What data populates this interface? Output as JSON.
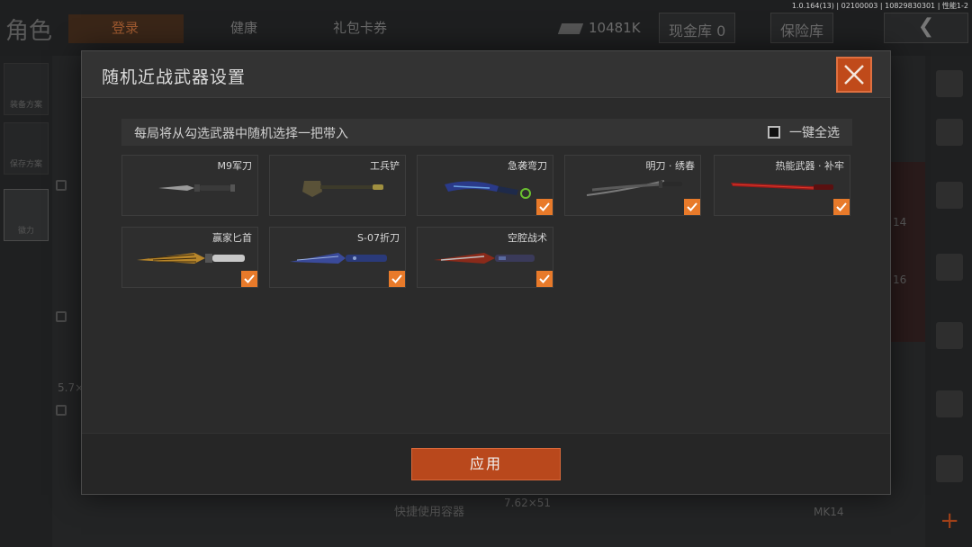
{
  "version": "1.0.164(13) | 02100003 | 10829830301 | 性能1-2",
  "background": {
    "title": "角色",
    "tabs": [
      {
        "label": "登录",
        "active": true
      },
      {
        "label": "健康",
        "active": false
      },
      {
        "label": "礼包卡券",
        "active": false
      }
    ],
    "money": "10481K",
    "cash_vault": "现金库 0",
    "safe_box": "保险库",
    "side_buttons": [
      "装备方案",
      "保存方案",
      "徽力"
    ],
    "bottom_text": "快捷使用容器",
    "left_text": "5.7×",
    "right_texts": [
      "14",
      "16",
      "7.62×51",
      "MK14"
    ]
  },
  "modal": {
    "title": "随机近战武器设置",
    "info": "每局将从勾选武器中随机选择一把带入",
    "select_all": "一键全选",
    "select_all_checked": false,
    "apply": "应用",
    "accent": "#e87a2a",
    "weapons": [
      {
        "name": "M9军刀",
        "checked": false,
        "icon": "bayonet-icon"
      },
      {
        "name": "工兵铲",
        "checked": false,
        "icon": "shovel-icon"
      },
      {
        "name": "急袭弯刀",
        "checked": true,
        "icon": "karambit-icon"
      },
      {
        "name": "明刀 · 绣春",
        "checked": true,
        "icon": "katana-icon"
      },
      {
        "name": "热能武器 · 补牢",
        "checked": true,
        "icon": "red-blade-icon"
      },
      {
        "name": "赢家匕首",
        "checked": true,
        "icon": "gold-dagger-icon"
      },
      {
        "name": "S-07折刀",
        "checked": true,
        "icon": "folding-knife-icon"
      },
      {
        "name": "空腔战术",
        "checked": true,
        "icon": "tactical-knife-icon"
      }
    ]
  }
}
